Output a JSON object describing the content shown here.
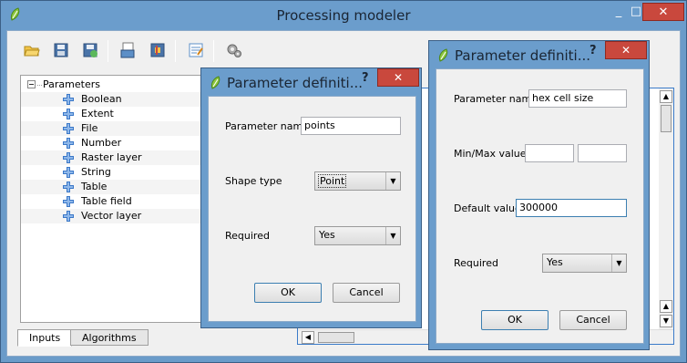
{
  "window": {
    "title": "Processing modeler",
    "minimize": "_",
    "maximize": "□",
    "close": "✕"
  },
  "toolbar": {
    "icons": [
      "open-icon",
      "save-icon",
      "save-as-icon",
      "export-image-icon",
      "export-python-icon",
      "edit-help-icon",
      "run-icon"
    ]
  },
  "tree": {
    "root": "Parameters",
    "items": [
      "Boolean",
      "Extent",
      "File",
      "Number",
      "Raster layer",
      "String",
      "Table",
      "Table field",
      "Vector layer"
    ]
  },
  "tabs": [
    "Inputs",
    "Algorithms"
  ],
  "dialog1": {
    "title": "Parameter definiti...",
    "help": "?",
    "close": "✕",
    "name_label": "Parameter name",
    "name_value": "points",
    "shape_label": "Shape type",
    "shape_value": "Point",
    "required_label": "Required",
    "required_value": "Yes",
    "ok": "OK",
    "cancel": "Cancel"
  },
  "dialog2": {
    "title": "Parameter definiti...",
    "help": "?",
    "close": "✕",
    "name_label": "Parameter name",
    "name_value": "hex cell size",
    "minmax_label": "Min/Max values",
    "min_value": "",
    "max_value": "",
    "default_label": "Default value",
    "default_value": "300000",
    "required_label": "Required",
    "required_value": "Yes",
    "ok": "OK",
    "cancel": "Cancel"
  },
  "colors": {
    "titlebar": "#6b9dcc",
    "close": "#c9483d",
    "plus": "#3b78c8"
  }
}
